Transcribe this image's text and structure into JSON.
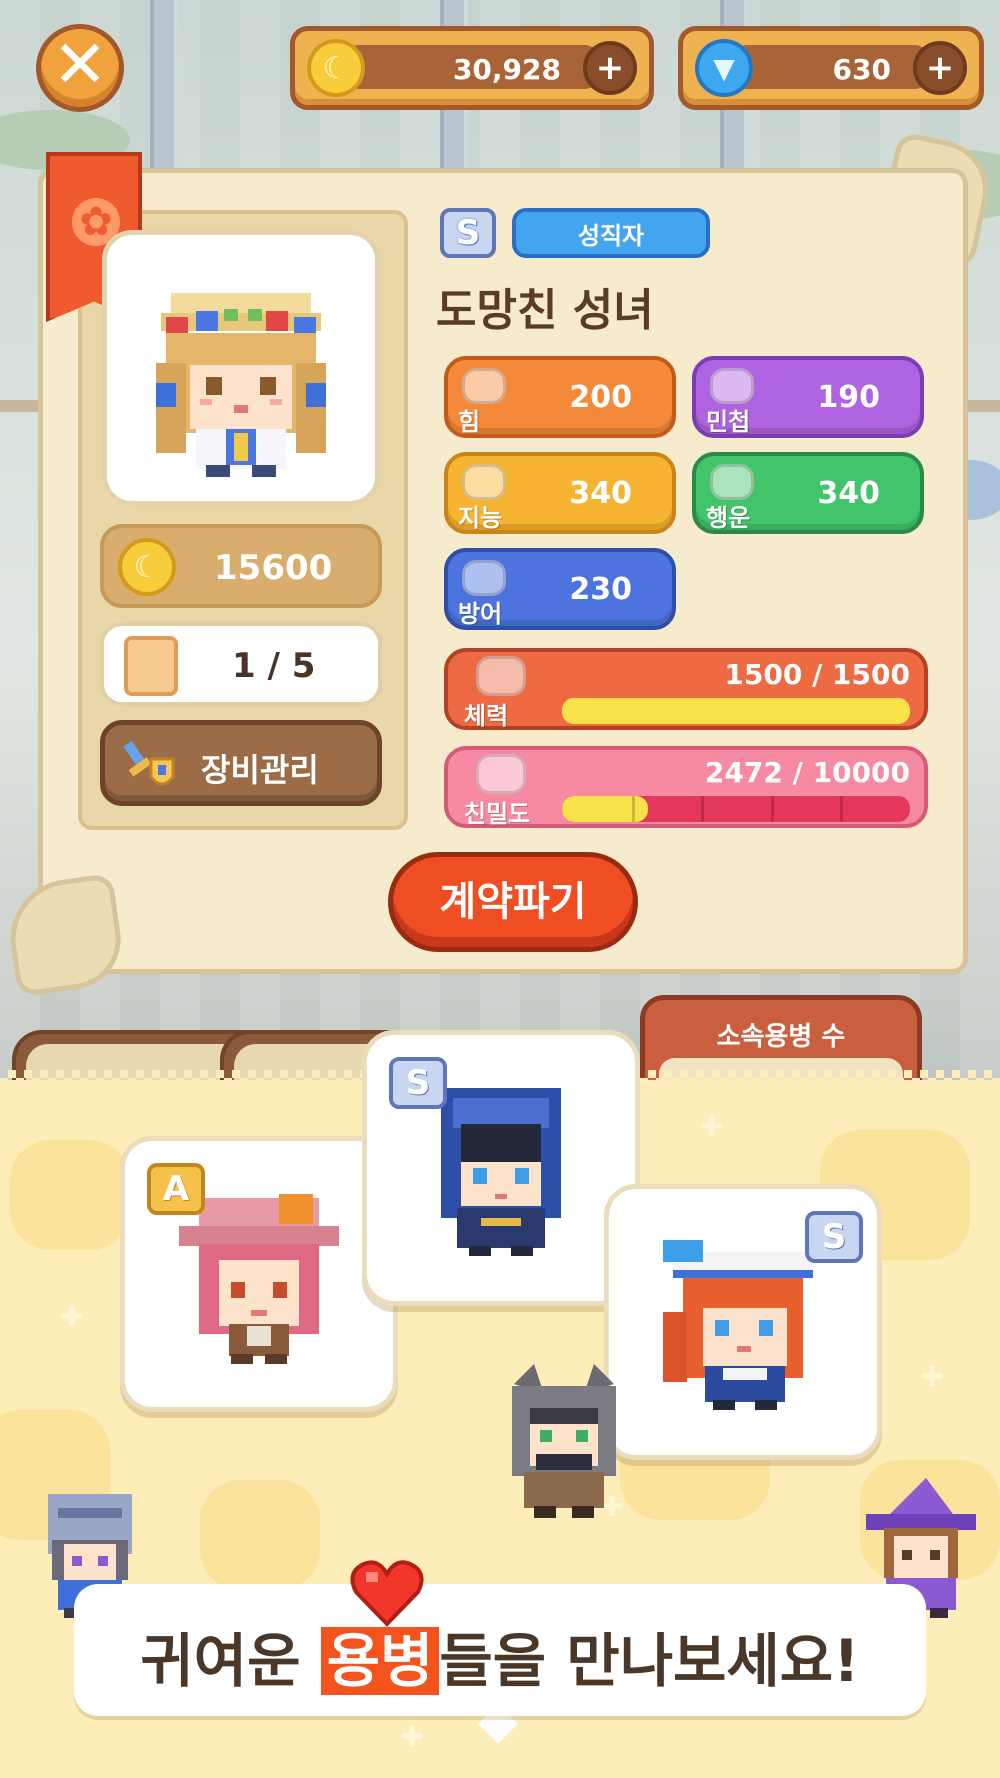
{
  "top_bar": {
    "gold": "30,928",
    "gems": "630",
    "close_icon": "close-icon",
    "plus_icon": "plus-icon"
  },
  "character": {
    "rank": "S",
    "class": "성직자",
    "name": "도망친 성녀",
    "price": "15600",
    "count": "1 / 5",
    "equip_label": "장비관리",
    "stats": [
      {
        "name": "힘",
        "value": "200",
        "color": "#f5893a",
        "border": "#c45a18"
      },
      {
        "name": "민첩",
        "value": "190",
        "color": "#b063e0",
        "border": "#7e3cb2"
      },
      {
        "name": "지능",
        "value": "340",
        "color": "#f7b332",
        "border": "#c9841a"
      },
      {
        "name": "행운",
        "value": "340",
        "color": "#42c46a",
        "border": "#2a8a46"
      },
      {
        "name": "방어",
        "value": "230",
        "color": "#4d74de",
        "border": "#2d4fa8"
      }
    ],
    "hp": {
      "label": "체력",
      "value": "1500 / 1500",
      "fraction": 1.0
    },
    "affinity": {
      "label": "친밀도",
      "value": "2472 / 10000",
      "fraction": 0.2472
    }
  },
  "contract_button": "계약파기",
  "roster_panel": {
    "label": "소속용병 수"
  },
  "cards": [
    {
      "rank": "A"
    },
    {
      "rank": "S"
    },
    {
      "rank": "S"
    }
  ],
  "promo": {
    "before": "귀여운 ",
    "highlight": "용병",
    "after": "들을 만나보세요!"
  }
}
